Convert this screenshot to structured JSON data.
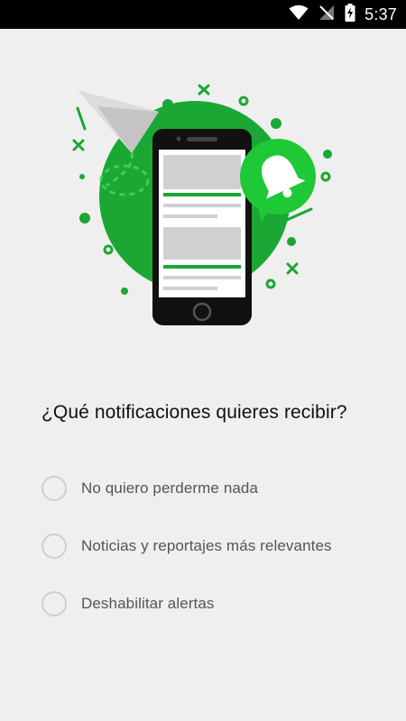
{
  "status_bar": {
    "time": "5:37",
    "icons": [
      "wifi-icon",
      "signal-off-icon",
      "battery-charging-icon"
    ]
  },
  "illustration": {
    "icons": [
      "paper-plane-icon",
      "phone-icon",
      "bell-icon"
    ],
    "accent": "#1aa734",
    "accent_dark": "#0e7a22",
    "bubble": "#1ec836"
  },
  "prompt": {
    "question": "¿Qué notificaciones quieres recibir?"
  },
  "options": [
    {
      "label": "No quiero perderme nada",
      "selected": false
    },
    {
      "label": "Noticias y reportajes más relevantes",
      "selected": false
    },
    {
      "label": "Deshabilitar alertas",
      "selected": false
    }
  ]
}
